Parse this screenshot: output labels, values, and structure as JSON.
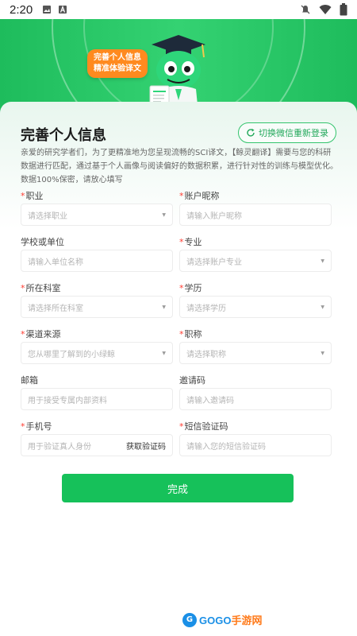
{
  "status_bar": {
    "time": "2:20"
  },
  "banner": {
    "bubble_line1": "完善个人信息",
    "bubble_line2": "精准体验译文"
  },
  "page": {
    "title": "完善个人信息",
    "switch_label": "切换微信重新登录",
    "intro": "亲爱的研究学者们，为了更精准地为您呈现流畅的SCI译文，【鲸灵翻译】需要与您的科研数据进行匹配，通过基于个人画像与阅读偏好的数据积累，进行针对性的训练与模型优化。数据100%保密，请放心填写"
  },
  "form": {
    "fields": [
      {
        "label": "职业",
        "required": true,
        "placeholder": "请选择职业",
        "type": "select"
      },
      {
        "label": "账户昵称",
        "required": true,
        "placeholder": "请输入账户昵称",
        "type": "input"
      },
      {
        "label": "学校或单位",
        "required": false,
        "placeholder": "请输入单位名称",
        "type": "input"
      },
      {
        "label": "专业",
        "required": true,
        "placeholder": "请选择账户专业",
        "type": "select"
      },
      {
        "label": "所在科室",
        "required": true,
        "placeholder": "请选择所在科室",
        "type": "select"
      },
      {
        "label": "学历",
        "required": true,
        "placeholder": "请选择学历",
        "type": "select"
      },
      {
        "label": "渠道来源",
        "required": true,
        "placeholder": "您从哪里了解到的小绿鲸",
        "type": "select"
      },
      {
        "label": "职称",
        "required": true,
        "placeholder": "请选择职称",
        "type": "select"
      },
      {
        "label": "邮箱",
        "required": false,
        "placeholder": "用于接受专属内部资料",
        "type": "input"
      },
      {
        "label": "邀请码",
        "required": false,
        "placeholder": "请输入邀请码",
        "type": "input"
      },
      {
        "label": "手机号",
        "required": true,
        "placeholder": "用于验证真人身份",
        "type": "input",
        "action": "获取验证码"
      },
      {
        "label": "短信验证码",
        "required": true,
        "placeholder": "请输入您的短信验证码",
        "type": "input"
      }
    ],
    "submit_label": "完成"
  },
  "watermark": {
    "logo": "G",
    "text_en": "GOGO",
    "text_cn": "手游网"
  },
  "colors": {
    "primary": "#16c15a",
    "required": "#ff3b30",
    "accent": "#ff8a1f"
  },
  "icons": [
    "image-icon",
    "a-icon",
    "mute-icon",
    "wifi-icon",
    "battery-icon",
    "refresh-icon",
    "dropdown-caret-icon"
  ]
}
